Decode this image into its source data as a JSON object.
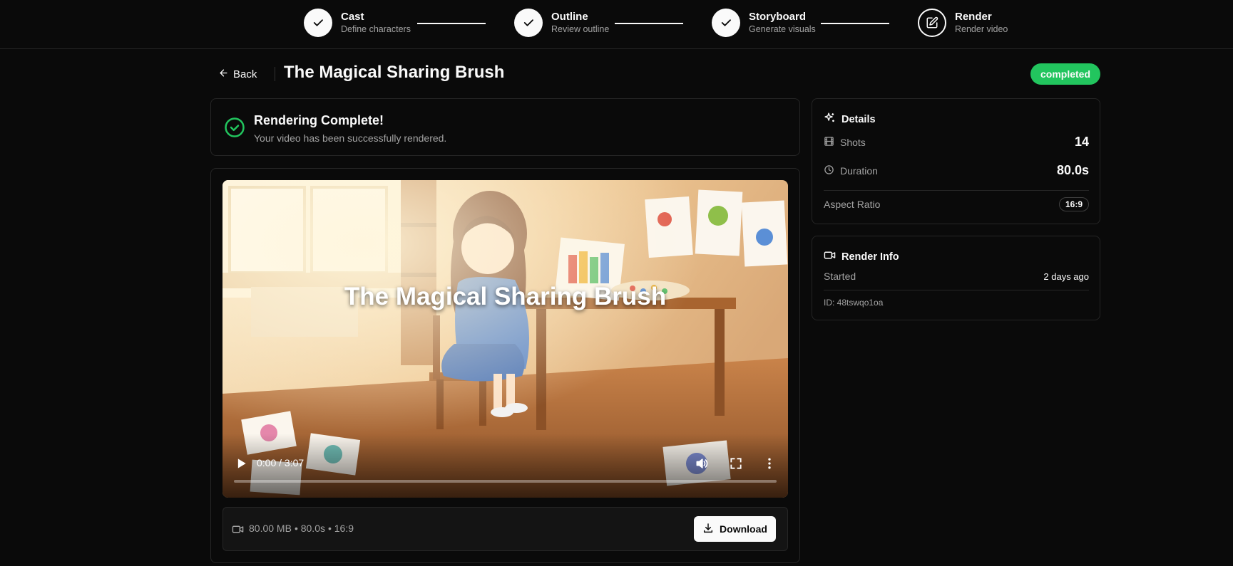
{
  "stepper": {
    "steps": [
      {
        "label": "Cast",
        "sub": "Define characters",
        "state": "done"
      },
      {
        "label": "Outline",
        "sub": "Review outline",
        "state": "done"
      },
      {
        "label": "Storyboard",
        "sub": "Generate visuals",
        "state": "done"
      },
      {
        "label": "Render",
        "sub": "Render video",
        "state": "current"
      }
    ]
  },
  "header": {
    "back_label": "Back",
    "title": "The Magical Sharing Brush",
    "status": "completed"
  },
  "success": {
    "title": "Rendering Complete!",
    "subtitle": "Your video has been successfully rendered."
  },
  "video": {
    "overlay_title": "The Magical Sharing Brush",
    "time": "0:00 / 3:07",
    "progress": 0,
    "icons": [
      "play-icon",
      "volume-icon",
      "fullscreen-icon",
      "more-vertical-icon"
    ]
  },
  "file": {
    "size": "80.00 MB",
    "duration": "• 80.0s",
    "ratio": "• 16:9",
    "download_label": "Download"
  },
  "details": {
    "title": "Details",
    "shots_label": "Shots",
    "shots_value": "14",
    "duration_label": "Duration",
    "duration_value": "80.0s",
    "aspect_label": "Aspect Ratio",
    "aspect_value": "16:9"
  },
  "render_info": {
    "title": "Render Info",
    "started_label": "Started",
    "started_value": "2 days ago",
    "id": "ID: 48tswqo1oa"
  },
  "colors": {
    "background": "#0a0a0a",
    "border": "#262626",
    "success": "#22c55e",
    "text": "#fafafa",
    "muted": "#a3a3a3"
  }
}
